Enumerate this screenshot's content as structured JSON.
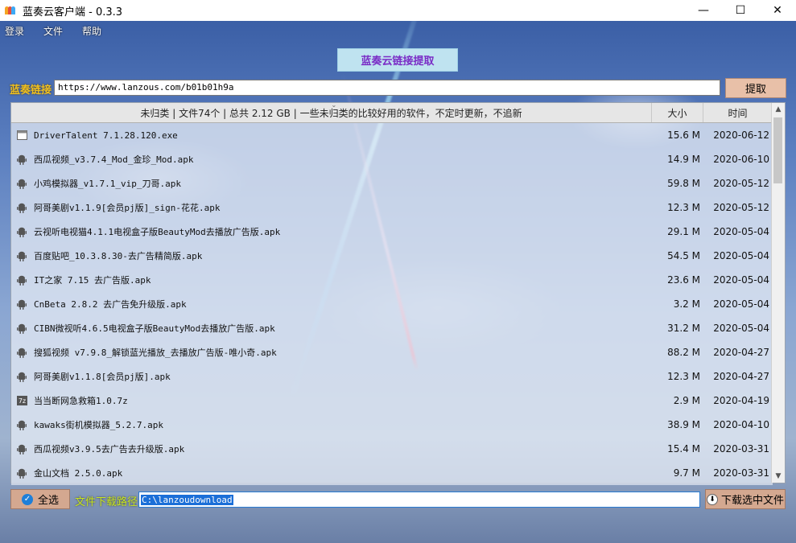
{
  "window": {
    "title": "蓝奏云客户端 - 0.3.3",
    "minimize": "—",
    "maximize": "☐",
    "close": "✕"
  },
  "menu": [
    "登录",
    "文件",
    "帮助"
  ],
  "tab": {
    "label": "蓝奏云链接提取"
  },
  "link": {
    "label": "蓝奏链接",
    "value": "https://www.lanzous.com/b01b01h9a",
    "extract_label": "提取"
  },
  "table": {
    "header_name": "未归类 | 文件74个 | 总共 2.12 GB | 一些未归类的比较好用的软件，不定时更新，不追新",
    "header_size": "大小",
    "header_time": "时间",
    "rows": [
      {
        "icon": "exe",
        "name": "DriverTalent 7.1.28.120.exe",
        "size": "15.6 M",
        "time": "2020-06-12"
      },
      {
        "icon": "apk",
        "name": "西瓜视频_v3.7.4_Mod_金珍_Mod.apk",
        "size": "14.9 M",
        "time": "2020-06-10"
      },
      {
        "icon": "apk",
        "name": "小鸡模拟器_v1.7.1_vip_刀哥.apk",
        "size": "59.8 M",
        "time": "2020-05-12"
      },
      {
        "icon": "apk",
        "name": "阿哥美剧v1.1.9[会员pj版]_sign-花花.apk",
        "size": "12.3 M",
        "time": "2020-05-12"
      },
      {
        "icon": "apk",
        "name": "云视听电视猫4.1.1电视盒子版BeautyMod去播放广告版.apk",
        "size": "29.1 M",
        "time": "2020-05-04"
      },
      {
        "icon": "apk",
        "name": "百度贴吧_10.3.8.30-去广告精简版.apk",
        "size": "54.5 M",
        "time": "2020-05-04"
      },
      {
        "icon": "apk",
        "name": "IT之家 7.15 去广告版.apk",
        "size": "23.6 M",
        "time": "2020-05-04"
      },
      {
        "icon": "apk",
        "name": "CnBeta 2.8.2 去广告免升级版.apk",
        "size": "3.2 M",
        "time": "2020-05-04"
      },
      {
        "icon": "apk",
        "name": "CIBN微视听4.6.5电视盒子版BeautyMod去播放广告版.apk",
        "size": "31.2 M",
        "time": "2020-05-04"
      },
      {
        "icon": "apk",
        "name": "搜狐视频 v7.9.8_解锁蓝光播放_去播放广告版-唯小奇.apk",
        "size": "88.2 M",
        "time": "2020-04-27"
      },
      {
        "icon": "apk",
        "name": "阿哥美剧v1.1.8[会员pj版].apk",
        "size": "12.3 M",
        "time": "2020-04-27"
      },
      {
        "icon": "7z",
        "name": "当当断网急救箱1.0.7z",
        "size": "2.9 M",
        "time": "2020-04-19"
      },
      {
        "icon": "apk",
        "name": "kawaks街机模拟器_5.2.7.apk",
        "size": "38.9 M",
        "time": "2020-04-10"
      },
      {
        "icon": "apk",
        "name": "西瓜视频v3.9.5去广告去升级版.apk",
        "size": "15.4 M",
        "time": "2020-03-31"
      },
      {
        "icon": "apk",
        "name": "金山文档 2.5.0.apk",
        "size": "9.7 M",
        "time": "2020-03-31"
      }
    ]
  },
  "bottom": {
    "select_all_label": "全选",
    "path_label": "文件下载路径",
    "path_value": "C:\\lanzoudownload",
    "download_label": "下载选中文件"
  },
  "colors": {
    "tab_bg": "#bfe3f0",
    "tab_text": "#7a2cc6",
    "link_label": "#f0c020",
    "path_label": "#c8e620",
    "button_bg": "#d4a890"
  }
}
